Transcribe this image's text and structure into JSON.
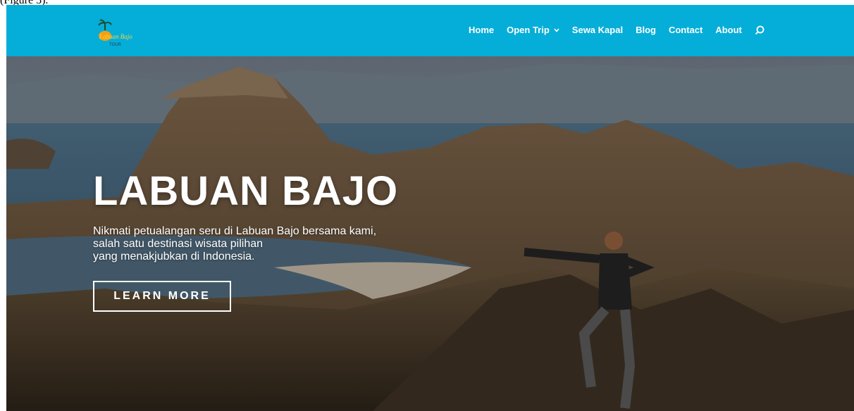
{
  "caption": "(Figure 3).",
  "logo": {
    "text": "Labuan Bajo",
    "subtext": "TOUR"
  },
  "nav": {
    "items": [
      {
        "label": "Home"
      },
      {
        "label": "Open Trip"
      },
      {
        "label": "Sewa Kapal"
      },
      {
        "label": "Blog"
      },
      {
        "label": "Contact"
      },
      {
        "label": "About"
      }
    ]
  },
  "hero": {
    "title": "LABUAN BAJO",
    "lines": [
      "Nikmati petualangan seru di Labuan Bajo bersama kami,",
      "salah satu destinasi wisata pilihan",
      "yang menakjubkan di Indonesia."
    ],
    "button": "LEARN MORE"
  },
  "colors": {
    "nav_bg": "#05aed8",
    "text": "#ffffff"
  }
}
